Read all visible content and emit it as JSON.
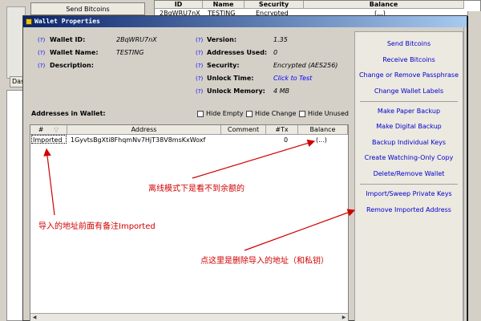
{
  "background": {
    "send_button": "Send Bitcoins",
    "tab_label": "Das",
    "table": {
      "headers": [
        "ID",
        "Name",
        "Security",
        "Balance"
      ],
      "row": {
        "id": "2BqWRU7nX",
        "name": "TESTING",
        "security": "Encrypted",
        "balance": "(...)"
      }
    }
  },
  "dialog": {
    "title": "Wallet Properties",
    "help_mark": "(?)",
    "wallet_id_label": "Wallet ID:",
    "wallet_id": "2BqWRU7nX",
    "wallet_name_label": "Wallet Name:",
    "wallet_name": "TESTING",
    "description_label": "Description:",
    "version_label": "Version:",
    "version": "1.35",
    "addresses_used_label": "Addresses Used:",
    "addresses_used": "0",
    "security_label": "Security:",
    "security": "Encrypted (AES256)",
    "unlock_time_label": "Unlock Time:",
    "unlock_time": "Click to Test",
    "unlock_memory_label": "Unlock Memory:",
    "unlock_memory": "4 MB",
    "addresses_heading": "Addresses in Wallet:",
    "checkboxes": {
      "hide_empty": "Hide Empty",
      "hide_change": "Hide Change",
      "hide_unused": "Hide Unused"
    },
    "address_table": {
      "headers": {
        "num": "#",
        "address": "Address",
        "comment": "Comment",
        "tx": "#Tx",
        "balance": "Balance"
      },
      "row": {
        "num": "Imported",
        "address": "1GyvtsBgXti8FhqmNv7HjT38V8msKxWoxf",
        "comment": "",
        "tx": "0",
        "balance": "(...)"
      }
    },
    "buttons": {
      "send_bitcoins": "Send Bitcoins",
      "receive_bitcoins": "Receive Bitcoins",
      "change_passphrase": "Change or Remove Passphrase",
      "change_labels": "Change Wallet Labels",
      "paper_backup": "Make Paper Backup",
      "digital_backup": "Make Digital Backup",
      "backup_keys": "Backup Individual Keys",
      "watching_copy": "Create Watching-Only Copy",
      "delete_wallet": "Delete/Remove Wallet",
      "import_sweep": "Import/Sweep Private Keys",
      "remove_imported": "Remove Imported Address"
    }
  },
  "annotations": {
    "offline_note": "离线模式下是看不到余额的",
    "imported_note": "导入的地址前面有备注Imported",
    "delete_note": "点这里是删除导入的地址（和私钥）"
  },
  "colors": {
    "annotation": "#d00000",
    "link": "#0000cc",
    "title_start": "#0a246a",
    "title_end": "#a6caf0"
  }
}
